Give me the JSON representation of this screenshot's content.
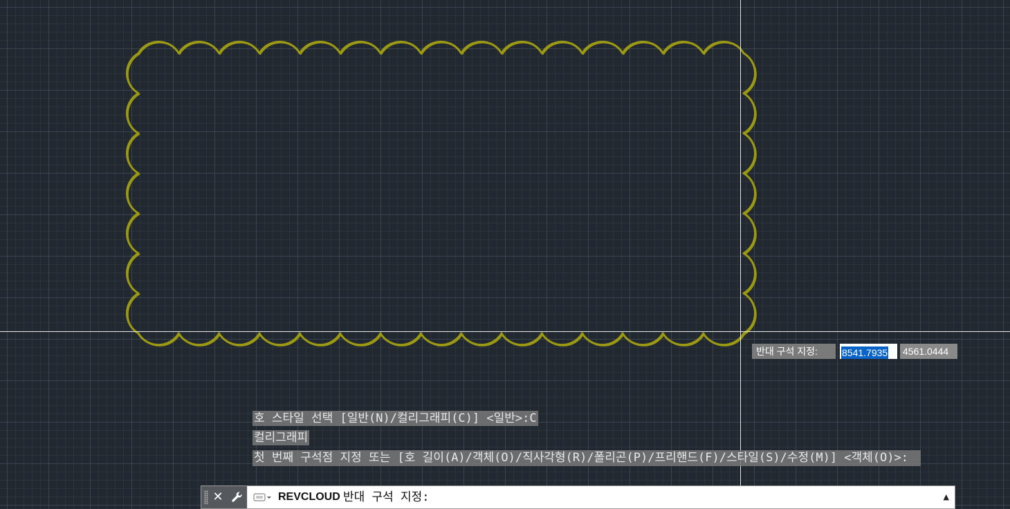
{
  "colors": {
    "background": "#212830",
    "cloud": "#9c9a14",
    "crosshair": "#e6e6e6",
    "selection": "#0a64c8"
  },
  "dynamic_input": {
    "prompt": "반대 구석 지정:",
    "x_value": "8541.7935",
    "y_value": "4561.0444"
  },
  "command_history": [
    "호 스타일 선택 [일반(N)/컬리그래피(C)] <일반>:C",
    "컬리그래피",
    "첫 번째 구석점 지정 또는 [호 길이(A)/객체(O)/직사각형(R)/폴리곤(P)/프리핸드(F)/스타일(S)/수정(M)] <객체(O)>:"
  ],
  "command_line": {
    "command": "REVCLOUD",
    "prompt": "반대 구석 지정:",
    "icons": [
      "grip-handle",
      "close-icon",
      "wrench-icon",
      "command-prompt-icon",
      "history-arrow-icon"
    ]
  }
}
